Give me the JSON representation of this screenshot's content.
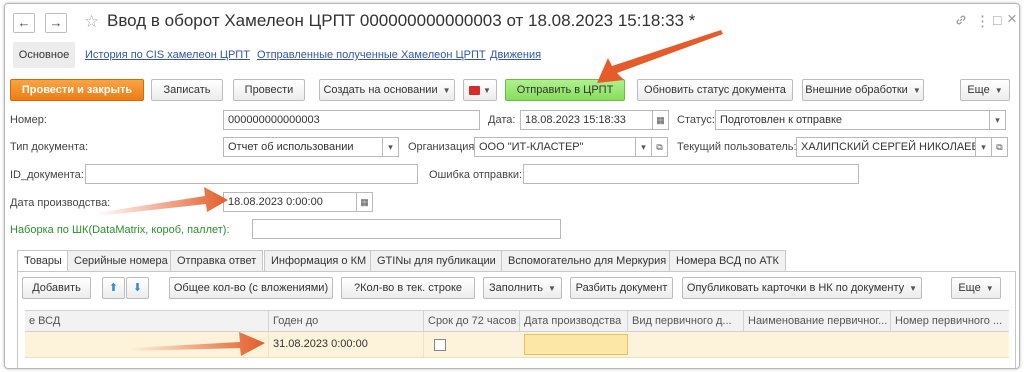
{
  "window": {
    "title": "Ввод в оборот Хамелеон ЦРПТ 000000000000003 от 18.08.2023 15:18:33 *",
    "back_icon": "←",
    "forward_icon": "→",
    "star_icon": "☆",
    "link_icon": "🔗",
    "more_icon": "⋮",
    "maximize_icon": "□",
    "close_icon": "×"
  },
  "page_tabs": {
    "main": "Основное",
    "links": [
      "История по CIS хамелеон ЦРПТ",
      "Отправленные полученные Хамелеон ЦРПТ",
      "Движения"
    ]
  },
  "toolbar": {
    "post_close": "Провести и закрыть",
    "save": "Записать",
    "post": "Провести",
    "create_based": "Создать на основании",
    "send_crpt": "Отправить в ЦРПТ",
    "update_status": "Обновить статус документа",
    "external": "Внешние обработки",
    "more": "Еще"
  },
  "form": {
    "number_label": "Номер:",
    "number_value": "000000000000003",
    "date_label": "Дата:",
    "date_value": "18.08.2023 15:18:33",
    "status_label": "Статус:",
    "status_value": "Подготовлен к отправке",
    "doc_type_label": "Тип документа:",
    "doc_type_value": "Отчет об использовании",
    "org_label": "Организация:",
    "org_value": "ООО \"ИТ-КЛАСТЕР\"",
    "user_label": "Текущий пользователь:",
    "user_value": "ХАЛИПСКИЙ СЕРГЕЙ НИКОЛАЕВИЧ",
    "id_label": "ID_документа:",
    "id_value": "",
    "error_label": "Ошибка отправки:",
    "error_value": "",
    "prod_date_label": "Дата производства:",
    "prod_date_value": "18.08.2023  0:00:00",
    "barcode_label": "Наборка по ШК(DataMatrix, короб, паллет):",
    "barcode_value": ""
  },
  "inner_tabs": [
    "Товары",
    "Серийные номера",
    "Отправка ответ",
    "Информация о КМ",
    "GTINы для публикации",
    "Вспомогательно для Меркурия",
    "Номера ВСД по АТК"
  ],
  "grid_toolbar": {
    "add": "Добавить",
    "total_qty": "Общее кол-во (с вложениями)",
    "qty_current": "?Кол-во в тек. строке",
    "fill": "Заполнить",
    "split": "Разбить документ",
    "publish": "Опубликовать карточки в НК по документу",
    "more": "Еще"
  },
  "grid": {
    "columns": [
      "е ВСД",
      "Годен до",
      "Срок до 72 часов",
      "Дата производства",
      "Вид первичного д...",
      "Наименование первичног...",
      "Номер первичного ..."
    ],
    "rows": [
      {
        "vsd": "",
        "expiry": "31.08.2023 0:00:00",
        "within72": false,
        "prod_date": "",
        "primary_type": "",
        "primary_name": "",
        "primary_number": ""
      }
    ]
  },
  "colors": {
    "orange_button": "#ee7c12",
    "green_button": "#86dd5c",
    "arrow": "#e35c2a",
    "selected_row": "#fcf3da",
    "link": "#3355aa"
  }
}
